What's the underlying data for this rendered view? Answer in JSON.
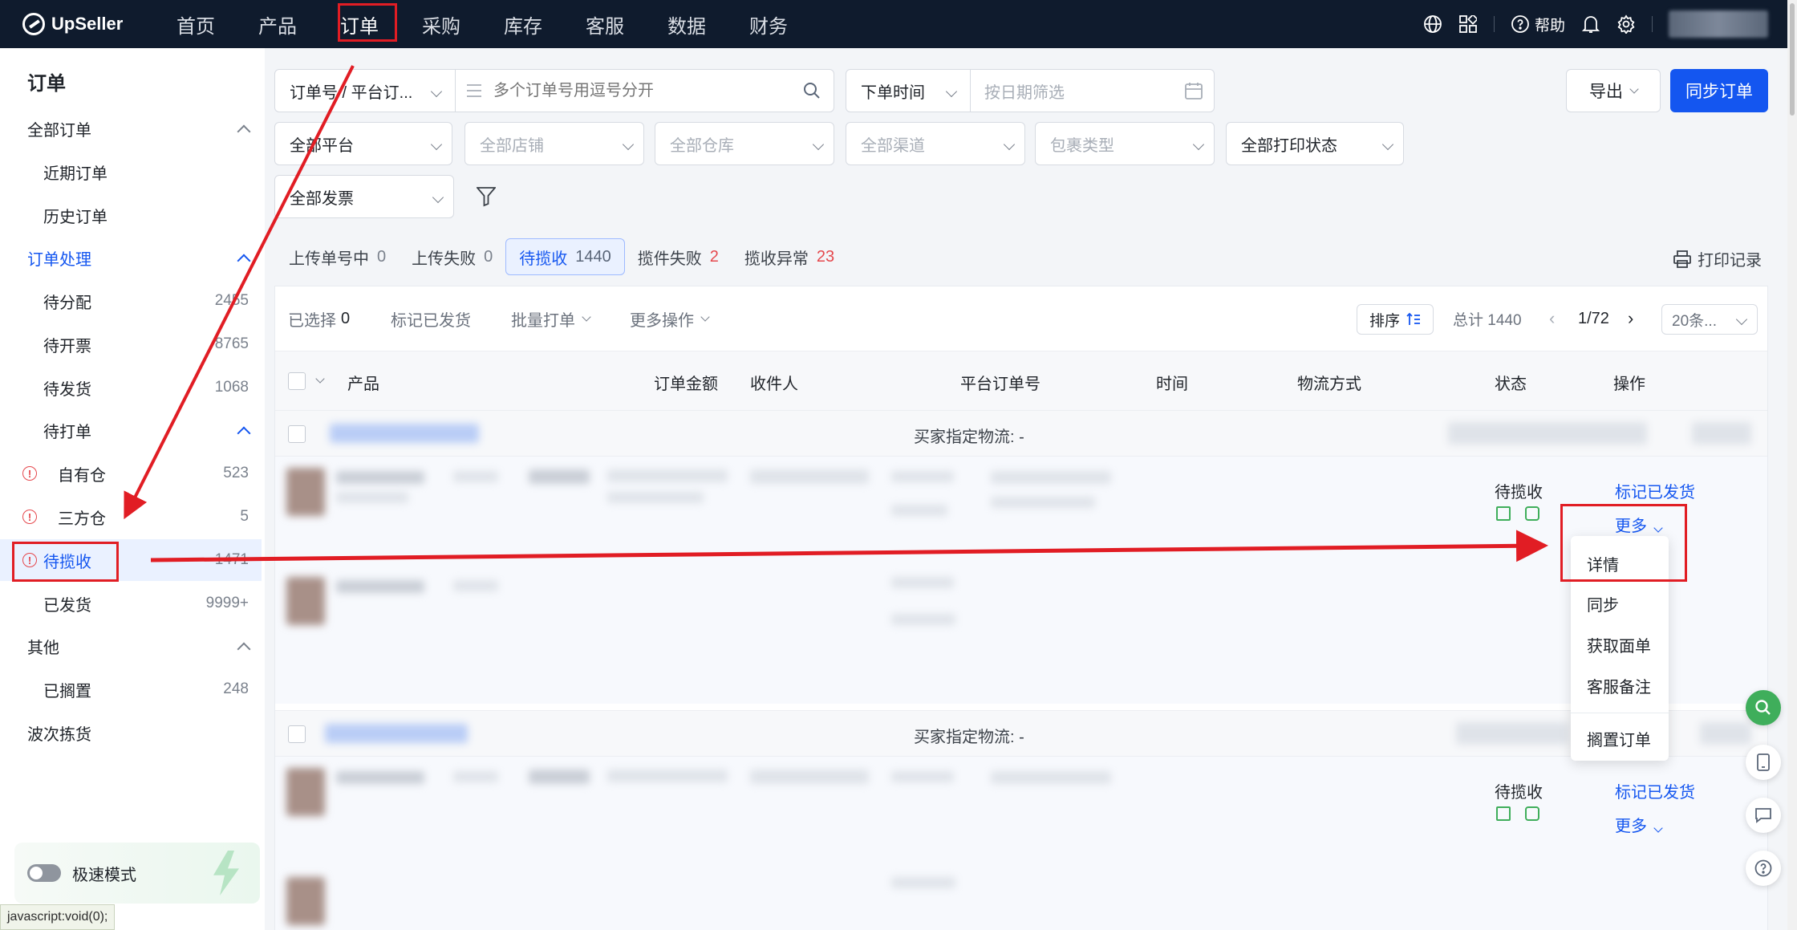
{
  "nav": {
    "brand": "UpSeller",
    "items": [
      "首页",
      "产品",
      "订单",
      "采购",
      "库存",
      "客服",
      "数据",
      "财务"
    ],
    "help": "帮助"
  },
  "sidebar": {
    "title": "订单",
    "all_orders": "全部订单",
    "recent": "近期订单",
    "history": "历史订单",
    "processing": "订单处理",
    "to_assign": {
      "label": "待分配",
      "count": "2455"
    },
    "to_invoice": {
      "label": "待开票",
      "count": "8765"
    },
    "to_ship": {
      "label": "待发货",
      "count": "1068"
    },
    "to_print": "待打单",
    "own_wh": {
      "label": "自有仓",
      "count": "523"
    },
    "third_wh": {
      "label": "三方仓",
      "count": "5"
    },
    "to_pickup": {
      "label": "待揽收",
      "count": "1471"
    },
    "shipped": {
      "label": "已发货",
      "count": "9999+"
    },
    "other": "其他",
    "shelved": {
      "label": "已搁置",
      "count": "248"
    },
    "wave": "波次拣货",
    "speed_mode": "极速模式",
    "status_url": "javascript:void(0);"
  },
  "filters": {
    "order_type": "订单号 / 平台订...",
    "order_search_placeholder": "多个订单号用逗号分开",
    "time_type": "下单时间",
    "date_placeholder": "按日期筛选",
    "export": "导出",
    "sync": "同步订单",
    "platform": "全部平台",
    "store": "全部店铺",
    "warehouse": "全部仓库",
    "channel": "全部渠道",
    "package": "包裹类型",
    "print_status": "全部打印状态",
    "invoice": "全部发票"
  },
  "tabs": [
    {
      "label": "上传单号中",
      "count": "0"
    },
    {
      "label": "上传失败",
      "count": "0"
    },
    {
      "label": "待揽收",
      "count": "1440"
    },
    {
      "label": "揽件失败",
      "count": "2"
    },
    {
      "label": "揽收异常",
      "count": "23"
    }
  ],
  "print_record": "打印记录",
  "toolbar": {
    "selected_label": "已选择",
    "selected_count": "0",
    "mark_shipped": "标记已发货",
    "batch_print": "批量打单",
    "more_ops": "更多操作",
    "sort": "排序",
    "total": "总计 1440",
    "page": "1/72",
    "per_page": "20条..."
  },
  "columns": [
    "产品",
    "订单金额",
    "收件人",
    "平台订单号",
    "时间",
    "物流方式",
    "状态",
    "操作"
  ],
  "rows": [
    {
      "group_label": "买家指定物流: -",
      "status": "待揽收",
      "action": "标记已发货",
      "more": "更多"
    },
    {
      "group_label": "买家指定物流: -",
      "status": "待揽收",
      "action": "标记已发货",
      "more": "更多"
    }
  ],
  "dropdown": [
    "详情",
    "同步",
    "获取面单",
    "客服备注",
    "搁置订单"
  ]
}
